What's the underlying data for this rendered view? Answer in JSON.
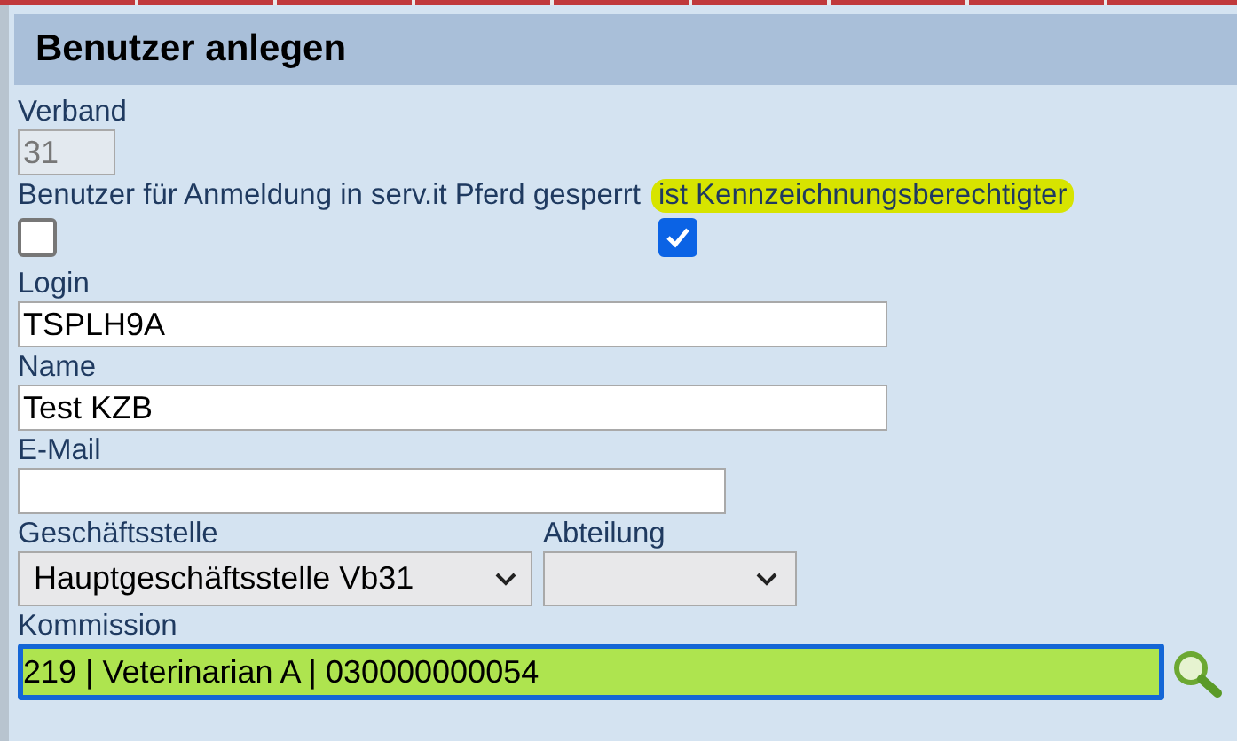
{
  "window": {
    "title": "Benutzer anlegen"
  },
  "verband": {
    "label": "Verband",
    "value": "31",
    "disabled": true
  },
  "checkboxes": [
    {
      "label": "Benutzer für Anmeldung in serv.it Pferd gesperrt",
      "checked": false,
      "highlighted": false
    },
    {
      "label": "ist Kennzeichnungsberechtigter",
      "checked": true,
      "highlighted": true
    }
  ],
  "login": {
    "label": "Login",
    "value": "TSPLH9A"
  },
  "name": {
    "label": "Name",
    "value": "Test KZB"
  },
  "email": {
    "label": "E-Mail"
  },
  "geschaeftsstelle": {
    "label": "Geschäftsstelle",
    "value": "Hauptgeschäftsstelle Vb31"
  },
  "abteilung": {
    "label": "Abteilung"
  },
  "kommission": {
    "label": "Kommission",
    "value": "219 | Veterinarian A | 030000000054",
    "focused": true
  }
}
